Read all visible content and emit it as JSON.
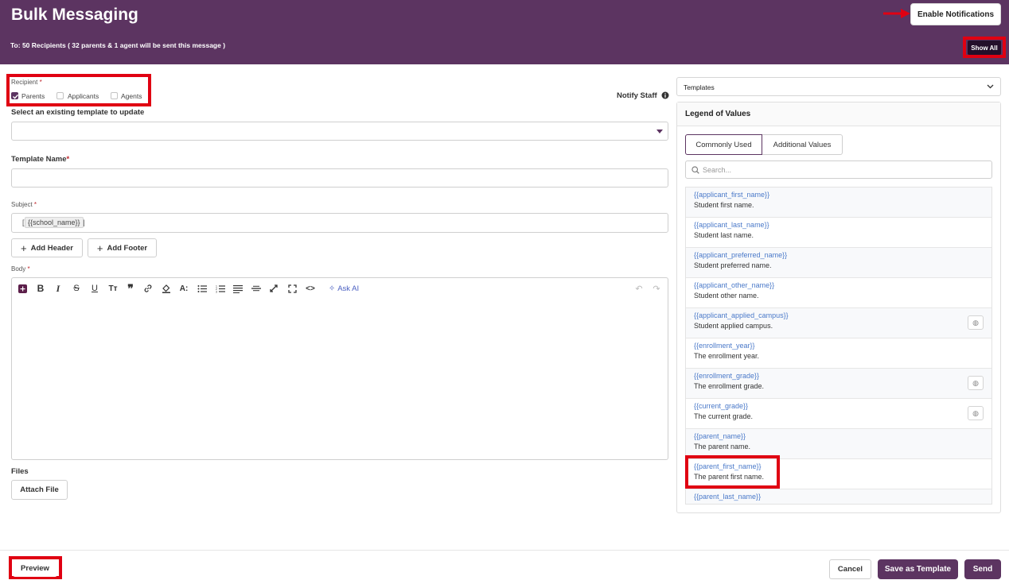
{
  "header": {
    "title": "Bulk Messaging",
    "to_line": "To: 50 Recipients ( 32 parents & 1 agent will be sent this message )",
    "enable_notifications": "Enable Notifications",
    "show_all": "Show All",
    "bg_color": "#5c3461"
  },
  "recipient": {
    "label": "Recipient",
    "required_mark": "*",
    "options": [
      {
        "label": "Parents",
        "checked": true
      },
      {
        "label": "Applicants",
        "checked": false
      },
      {
        "label": "Agents",
        "checked": false
      }
    ]
  },
  "notify_staff": "Notify Staff",
  "existing_template": {
    "label": "Select an existing template to update",
    "value": ""
  },
  "template_name": {
    "label": "Template Name",
    "required_mark": "*",
    "value": ""
  },
  "subject": {
    "label": "Subject",
    "required_mark": "*",
    "prefix": "[",
    "tag": "{{school_name}}",
    "suffix": "]"
  },
  "buttons": {
    "add_header": "Add Header",
    "add_footer": "Add Footer",
    "attach_file": "Attach File"
  },
  "body": {
    "label": "Body",
    "required_mark": "*",
    "ask_ai": "Ask AI"
  },
  "files": {
    "label": "Files"
  },
  "templates_select": {
    "value": "Templates"
  },
  "legend": {
    "title": "Legend of Values",
    "tabs": [
      {
        "label": "Commonly Used",
        "active": true
      },
      {
        "label": "Additional Values",
        "active": false
      }
    ],
    "search_placeholder": "Search...",
    "items": [
      {
        "key": "{{applicant_first_name}}",
        "desc": "Student first name.",
        "has_button": false
      },
      {
        "key": "{{applicant_last_name}}",
        "desc": "Student last name.",
        "has_button": false
      },
      {
        "key": "{{applicant_preferred_name}}",
        "desc": "Student preferred name.",
        "has_button": false
      },
      {
        "key": "{{applicant_other_name}}",
        "desc": "Student other name.",
        "has_button": false
      },
      {
        "key": "{{applicant_applied_campus}}",
        "desc": "Student applied campus.",
        "has_button": true
      },
      {
        "key": "{{enrollment_year}}",
        "desc": "The enrollment year.",
        "has_button": false
      },
      {
        "key": "{{enrollment_grade}}",
        "desc": "The enrollment grade.",
        "has_button": true
      },
      {
        "key": "{{current_grade}}",
        "desc": "The current grade.",
        "has_button": true
      },
      {
        "key": "{{parent_name}}",
        "desc": "The parent name.",
        "has_button": false
      },
      {
        "key": "{{parent_first_name}}",
        "desc": "The parent first name.",
        "has_button": false
      },
      {
        "key": "{{parent_last_name}}",
        "desc": "",
        "has_button": false
      }
    ]
  },
  "footer": {
    "preview": "Preview",
    "cancel": "Cancel",
    "save_template": "Save as Template",
    "send": "Send"
  }
}
